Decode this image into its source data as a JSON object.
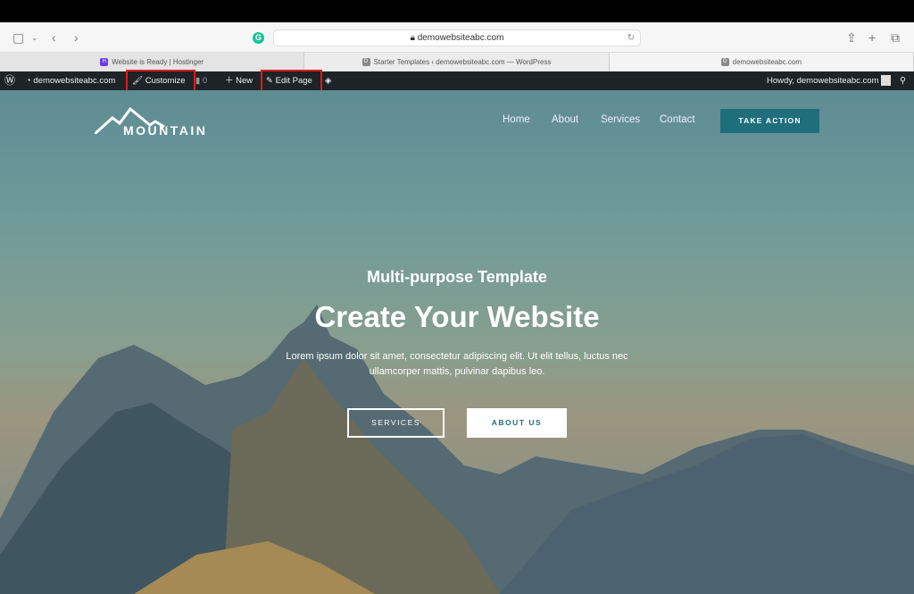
{
  "browser": {
    "url": "demowebsiteabc.com",
    "tabs": [
      {
        "label": "Website is Ready | Hostinger",
        "favicon": "H"
      },
      {
        "label": "Starter Templates ‹ demowebsiteabc.com — WordPress",
        "favicon": "D"
      },
      {
        "label": "demowebsiteabc.com",
        "favicon": "D"
      }
    ]
  },
  "adminbar": {
    "site": "demowebsiteabc.com",
    "customize": "Customize",
    "comments": "0",
    "new": "New",
    "edit": "Edit Page",
    "howdy": "Howdy, demowebsiteabc.com",
    "highlight_color": "#e01b1b"
  },
  "site": {
    "logo": "MOUNTAIN",
    "nav": [
      "Home",
      "About",
      "Services",
      "Contact"
    ],
    "cta": "TAKE ACTION",
    "subtitle": "Multi-purpose Template",
    "title": "Create Your Website",
    "description": "Lorem ipsum dolor sit amet, consectetur adipiscing elit. Ut elit tellus, luctus nec ullamcorper mattis, pulvinar dapibus leo.",
    "btn_services": "SERVICES",
    "btn_about": "ABOUT US",
    "accent": "#1e6e7c"
  }
}
